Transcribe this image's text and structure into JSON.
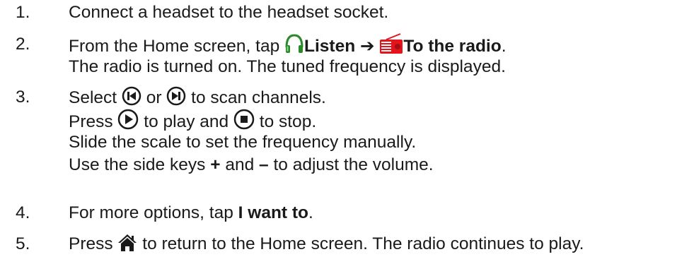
{
  "steps": [
    {
      "num": "1.",
      "text": "Connect a headset to the headset socket."
    },
    {
      "num": "2.",
      "pre": "From the Home screen, tap",
      "listen": "Listen",
      "arrow": "➔",
      "radio": "To the radio",
      "period": ".",
      "line2": "The radio is turned on. The tuned frequency is displayed."
    },
    {
      "num": "3.",
      "l1_a": "Select",
      "l1_or": "or",
      "l1_b": "to scan channels.",
      "l2_a": "Press",
      "l2_b": "to play and",
      "l2_c": "to stop.",
      "l3": "Slide the scale to set the frequency manually.",
      "l4_a": "Use the side keys",
      "plus": "+",
      "and": "and",
      "minus": "–",
      "l4_b": "to adjust the volume."
    },
    {
      "num": "4.",
      "pre": "For more options, tap",
      "bold": "I want to",
      "post": "."
    },
    {
      "num": "5.",
      "pre": "Press",
      "post": "to return to the Home screen. The radio continues to play."
    }
  ],
  "icons": {
    "headphones": "headphones-icon",
    "radio": "radio-icon",
    "prev": "previous-icon",
    "next": "next-icon",
    "play": "play-icon",
    "stop": "stop-icon",
    "home": "home-icon"
  },
  "colors": {
    "text": "#1a1a1a",
    "headphones": "#2a8a2a",
    "radio": "#e3141b"
  }
}
